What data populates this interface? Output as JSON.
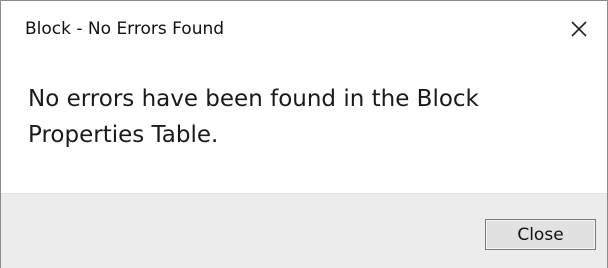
{
  "window": {
    "title": "Block - No Errors Found",
    "close_icon": "close-icon"
  },
  "message": {
    "text": "No errors have been found in the Block Properties Table."
  },
  "footer": {
    "close_label": "Close"
  }
}
